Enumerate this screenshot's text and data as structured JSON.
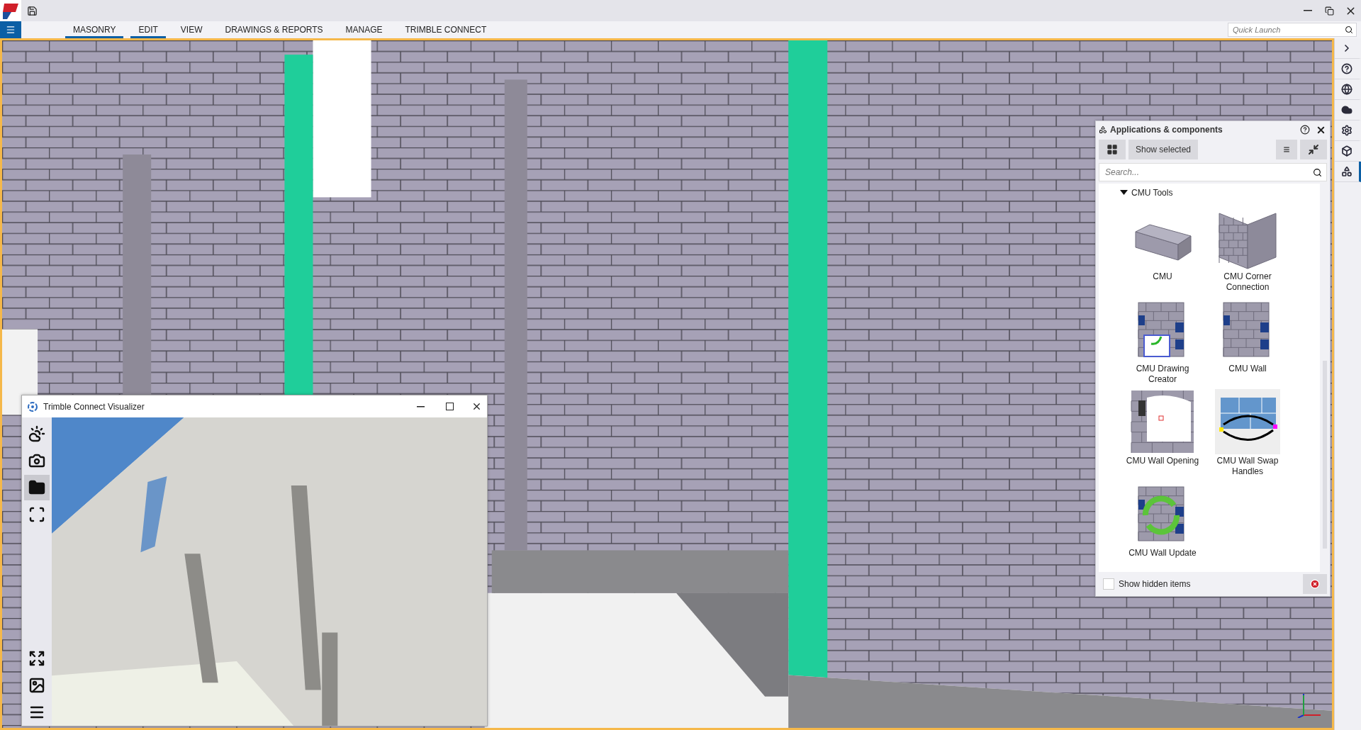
{
  "ribbon": {
    "tabs": [
      {
        "label": "MASONRY",
        "selected": true
      },
      {
        "label": "EDIT",
        "selected": true
      },
      {
        "label": "VIEW",
        "selected": false
      },
      {
        "label": "DRAWINGS & REPORTS",
        "selected": false
      },
      {
        "label": "MANAGE",
        "selected": false
      },
      {
        "label": "TRIMBLE CONNECT",
        "selected": false
      }
    ],
    "quick_launch": {
      "placeholder": "Quick Launch"
    }
  },
  "side_panel": {
    "buttons": [
      {
        "kind": "expand",
        "selected": false
      },
      {
        "kind": "help",
        "selected": false
      },
      {
        "kind": "globe",
        "selected": false
      },
      {
        "kind": "cloud",
        "selected": false
      },
      {
        "kind": "settings",
        "selected": false
      },
      {
        "kind": "cube",
        "selected": false
      },
      {
        "kind": "shapes",
        "selected": true
      }
    ]
  },
  "apps_panel": {
    "title": "Applications & components",
    "show_selected": "Show selected",
    "search": {
      "placeholder": "Search..."
    },
    "group": {
      "label": "CMU Tools",
      "expanded": true,
      "items": [
        {
          "label": "CMU",
          "kind": "block"
        },
        {
          "label": "CMU Corner Connection",
          "kind": "corner"
        },
        {
          "label": "CMU Drawing Creator",
          "kind": "drawing"
        },
        {
          "label": "CMU Wall",
          "kind": "wall"
        },
        {
          "label": "CMU Wall Opening",
          "kind": "opening"
        },
        {
          "label": "CMU Wall Swap Handles",
          "kind": "swap"
        },
        {
          "label": "CMU Wall Update",
          "kind": "update"
        }
      ]
    },
    "show_hidden": {
      "label": "Show hidden items",
      "checked": false
    }
  },
  "visualizer": {
    "title": "Trimble Connect Visualizer",
    "tools": [
      {
        "kind": "weather",
        "selected": false
      },
      {
        "kind": "snapshot",
        "selected": false
      },
      {
        "kind": "folder",
        "selected": true
      },
      {
        "kind": "frame",
        "selected": false
      }
    ],
    "bottom_tools": [
      {
        "kind": "fullscreen",
        "selected": false
      },
      {
        "kind": "image",
        "selected": false
      },
      {
        "kind": "menu",
        "selected": false
      }
    ]
  }
}
